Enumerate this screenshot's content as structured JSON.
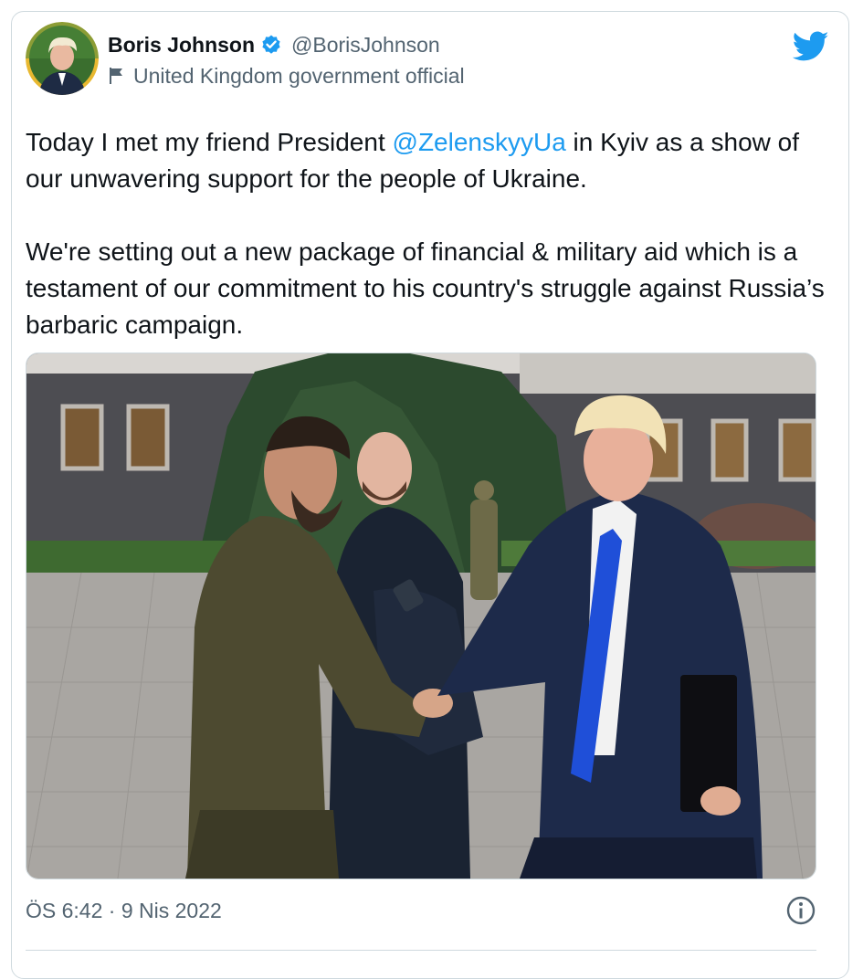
{
  "author": {
    "display_name": "Boris Johnson",
    "handle": "@BorisJohnson",
    "affiliation": "United Kingdom government official",
    "verified_icon": "verified-badge-icon",
    "affiliation_icon": "flag-icon"
  },
  "platform_icon": "twitter-bird-icon",
  "tweet": {
    "line1_before": "Today I met my friend President ",
    "mention": "@ZelenskyyUa",
    "line1_after": " in Kyiv as a show of our unwavering support for the people of Ukraine.",
    "paragraph2": "We're setting out a new package of financial & military aid which is a testament of our commitment to his country's struggle against Russia’s barbaric campaign."
  },
  "footer": {
    "timestamp": "ÖS 6:42 · 9 Nis 2022",
    "info_icon": "info-icon"
  },
  "colors": {
    "accent": "#1d9bf0",
    "text": "#0f1419",
    "secondary": "#536471",
    "border": "#cfd9de"
  }
}
